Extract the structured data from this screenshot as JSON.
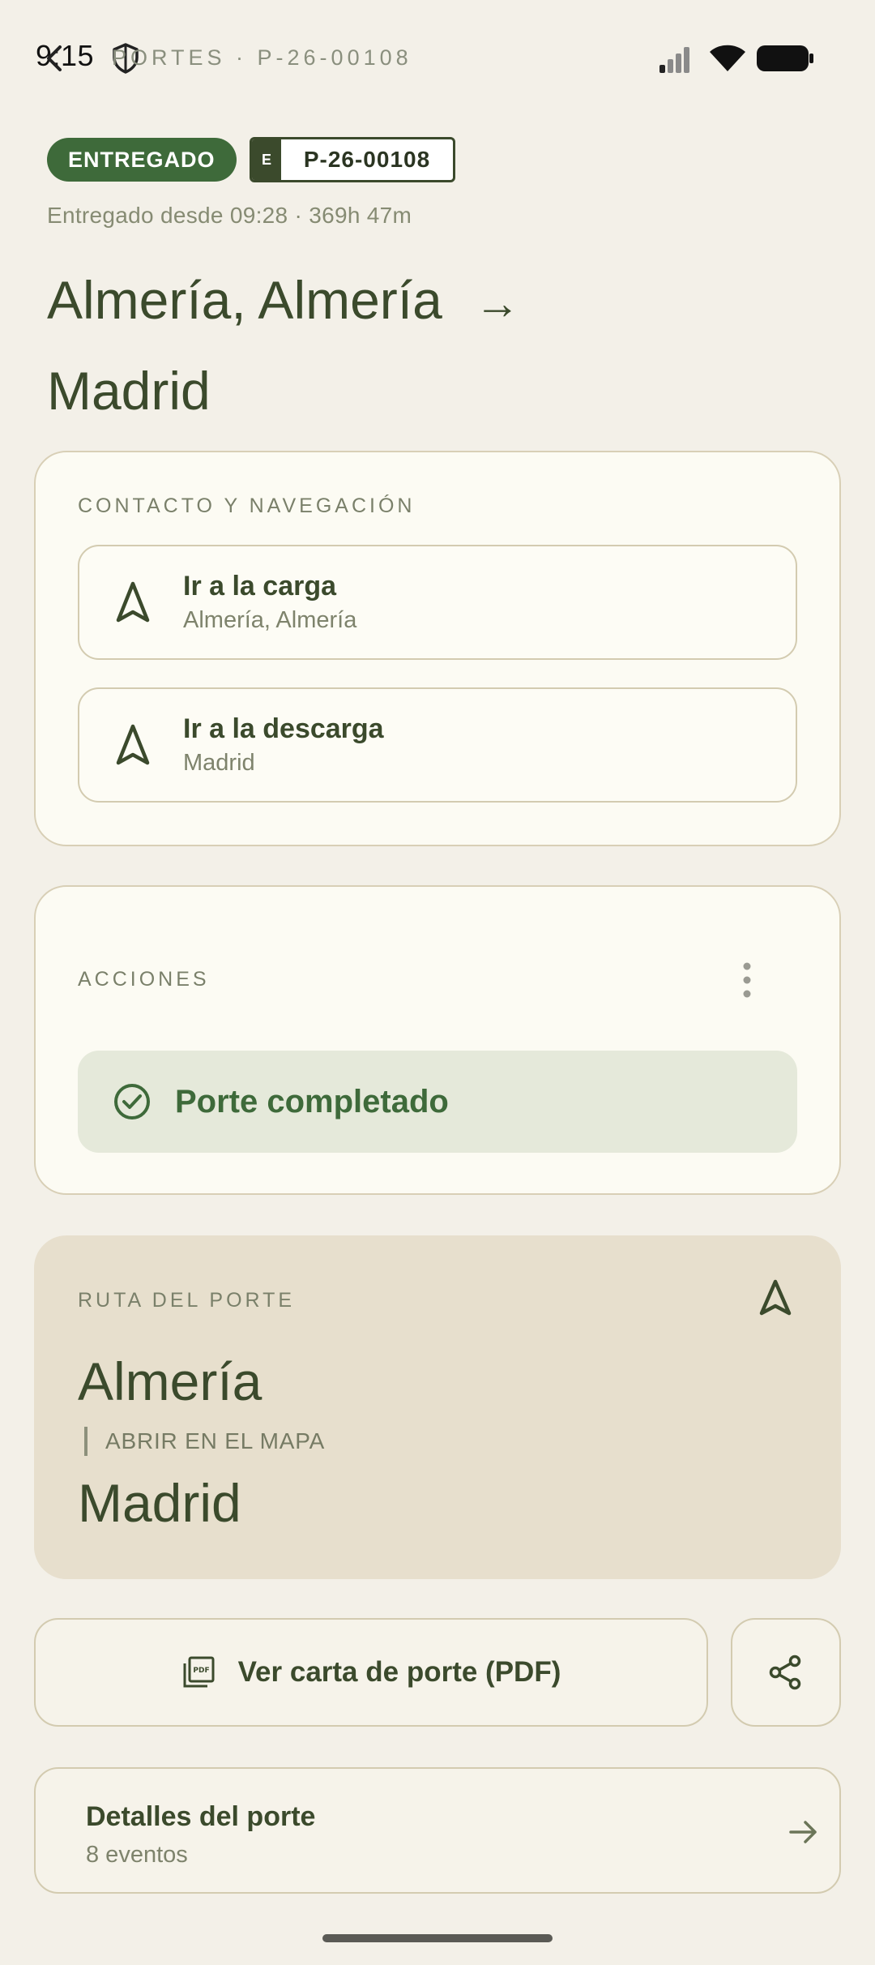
{
  "status_bar": {
    "time": "9:15",
    "signal_icon": "signal-icon",
    "wifi_icon": "wifi-icon",
    "battery_icon": "battery-icon"
  },
  "topbar": {
    "title": "PORTES · P-26-00108",
    "back_icon": "back-arrow-icon",
    "shield_icon": "shield-icon"
  },
  "header": {
    "status_badge": "ENTREGADO",
    "plate_prefix": "E",
    "plate_number": "P-26-00108",
    "since": "Entregado desde 09:28 · 369h 47m",
    "origin": "Almería, Almería",
    "arrow": "→",
    "destination": "Madrid"
  },
  "contact_card": {
    "label": "CONTACTO Y NAVEGACIÓN",
    "load": {
      "title": "Ir a la carga",
      "subtitle": "Almería, Almería"
    },
    "unload": {
      "title": "Ir a la descarga",
      "subtitle": "Madrid"
    }
  },
  "actions_card": {
    "label": "ACCIONES",
    "status": "Porte completado"
  },
  "route_card": {
    "label": "RUTA DEL PORTE",
    "from": "Almería",
    "link": "ABRIR EN EL MAPA",
    "to": "Madrid"
  },
  "buttons": {
    "pdf": "Ver carta de porte (PDF)",
    "details_title": "Detalles del porte",
    "details_subtitle": "8 eventos"
  },
  "colors": {
    "background": "#f3f0e8",
    "accent_green": "#3e6a3a",
    "text_dark": "#3b4a2c",
    "route_card_bg": "#e7dfcd"
  }
}
